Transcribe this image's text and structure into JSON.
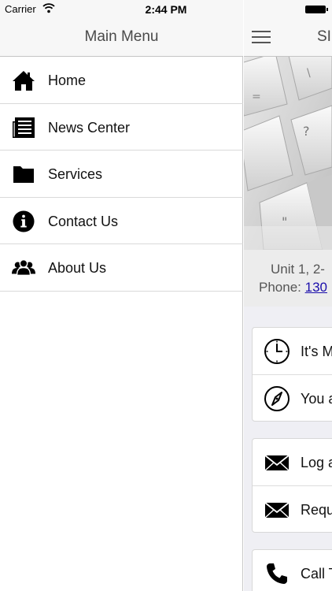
{
  "status": {
    "carrier": "Carrier",
    "time": "2:44 PM"
  },
  "menu": {
    "title": "Main Menu",
    "items": [
      {
        "label": "Home",
        "icon": "home-icon"
      },
      {
        "label": "News Center",
        "icon": "newspaper-icon"
      },
      {
        "label": "Services",
        "icon": "folder-icon"
      },
      {
        "label": "Contact Us",
        "icon": "info-icon"
      },
      {
        "label": "About Us",
        "icon": "users-icon"
      }
    ]
  },
  "main": {
    "title": "SI",
    "address": "Unit 1, 2-",
    "phone_label": "Phone:",
    "phone_number": "130",
    "cards": [
      {
        "rows": [
          {
            "text": "It's M",
            "icon": "clock-icon"
          },
          {
            "text": "You a",
            "icon": "compass-icon"
          }
        ]
      },
      {
        "rows": [
          {
            "text": "Log a",
            "icon": "envelope-icon"
          },
          {
            "text": "Requ",
            "icon": "envelope-icon"
          }
        ]
      },
      {
        "rows": [
          {
            "text": "Call T",
            "icon": "phone-icon"
          }
        ]
      }
    ]
  }
}
